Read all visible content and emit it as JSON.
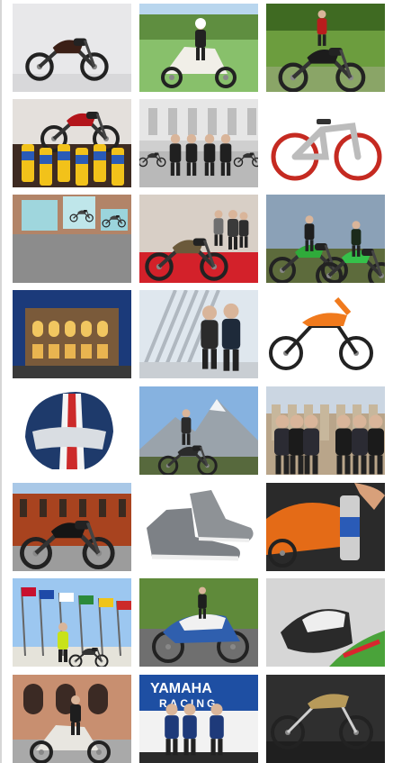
{
  "gallery": {
    "columns": 3,
    "items": [
      {
        "alt": "",
        "kind": "classic-motorcycle"
      },
      {
        "alt": "",
        "kind": "scooter-rider"
      },
      {
        "alt": "",
        "kind": "sport-motorcycle"
      },
      {
        "alt": "",
        "kind": "motorcycle-with-lube-cans"
      },
      {
        "alt": "",
        "kind": "people-on-piazza"
      },
      {
        "alt": "",
        "kind": "e-bike"
      },
      {
        "alt": "",
        "kind": "product-box"
      },
      {
        "alt": "",
        "kind": "vintage-motorcycle-red-carpet"
      },
      {
        "alt": "",
        "kind": "motocross-riders"
      },
      {
        "alt": "",
        "kind": "building-at-dusk"
      },
      {
        "alt": "",
        "kind": "couple-walking"
      },
      {
        "alt": "",
        "kind": "minicross-bike"
      },
      {
        "alt": "",
        "kind": "motorcycle-helmet"
      },
      {
        "alt": "",
        "kind": "rider-in-mountains"
      },
      {
        "alt": "",
        "kind": "officials-ceremony"
      },
      {
        "alt": "",
        "kind": "motorcycle-by-brick-building"
      },
      {
        "alt": "",
        "kind": "motorcycle-shoes"
      },
      {
        "alt": "",
        "kind": "spray-can-and-bike"
      },
      {
        "alt": "",
        "kind": "flags-and-riders"
      },
      {
        "alt": "",
        "kind": "superbike-on-track"
      },
      {
        "alt": "",
        "kind": "racer-leaning"
      },
      {
        "alt": "",
        "kind": "scooter-in-city"
      },
      {
        "alt": "",
        "kind": "yamaha-racing-stage",
        "banner_text": [
          "YAMAHA",
          "RACING"
        ]
      },
      {
        "alt": "",
        "kind": "custom-bike-dark"
      }
    ]
  }
}
